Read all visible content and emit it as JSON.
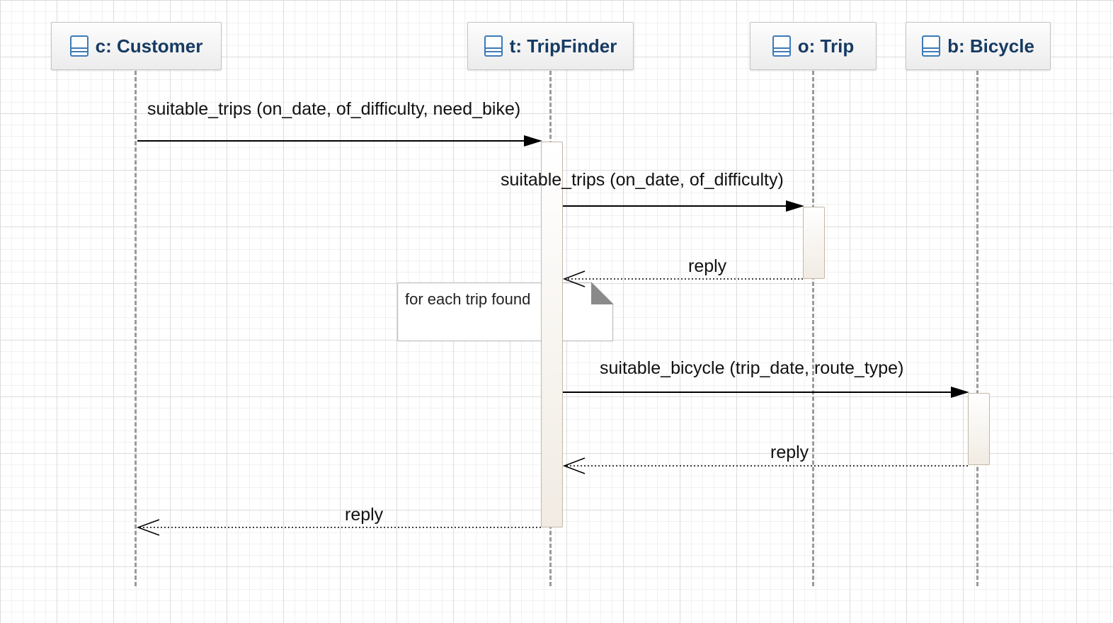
{
  "participants": [
    {
      "id": "customer",
      "label": "c: Customer"
    },
    {
      "id": "tripfinder",
      "label": "t: TripFinder"
    },
    {
      "id": "trip",
      "label": "o: Trip"
    },
    {
      "id": "bicycle",
      "label": "b: Bicycle"
    }
  ],
  "messages": [
    {
      "label": "suitable_trips (on_date, of_difficulty, need_bike)",
      "kind": "call"
    },
    {
      "label": "suitable_trips (on_date, of_difficulty)",
      "kind": "call"
    },
    {
      "label": "reply",
      "kind": "return"
    },
    {
      "label": "suitable_bicycle (trip_date, route_type)",
      "kind": "call"
    },
    {
      "label": "reply",
      "kind": "return"
    },
    {
      "label": "reply",
      "kind": "return"
    }
  ],
  "note": {
    "text": "for each trip found"
  },
  "colors": {
    "participant_text": "#163b63",
    "icon": "#3c7bb8",
    "lifeline": "#9a9a9a",
    "activation_border": "#c2b8a6"
  }
}
